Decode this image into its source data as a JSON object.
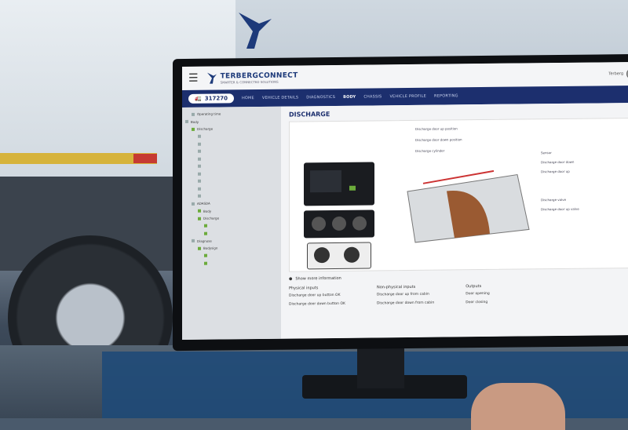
{
  "app": {
    "brand_name": "TERBERGCONNECT",
    "brand_tagline": "SMARTER & CONNECTED SOLUTIONS",
    "user_name": "Terberg"
  },
  "vehicle": {
    "id": "317270"
  },
  "nav": {
    "items": [
      "HOME",
      "VEHICLE DETAILS",
      "DIAGNOSTICS",
      "BODY",
      "CHASSIS",
      "VEHICLE PROFILE",
      "REPORTING"
    ],
    "active": "BODY"
  },
  "page": {
    "title": "DISCHARGE",
    "info": "Show more information"
  },
  "tree": [
    {
      "label": "Operating time",
      "level": 1,
      "status": "none"
    },
    {
      "label": "Body",
      "level": 0,
      "status": "none"
    },
    {
      "label": "Discharge",
      "level": 1,
      "status": "green"
    },
    {
      "label": "ADASDA",
      "level": 1,
      "status": "none"
    },
    {
      "label": "Body",
      "level": 2,
      "status": "green"
    },
    {
      "label": "Discharge",
      "level": 2,
      "status": "green"
    },
    {
      "label": "Diagnose",
      "level": 1,
      "status": "none"
    },
    {
      "label": "Bodysign",
      "level": 2,
      "status": "green"
    }
  ],
  "diagram": {
    "labels_left": [
      "Discharge door up position",
      "Discharge door down position",
      "Discharge cylinder"
    ],
    "labels_right": [
      "Sensor",
      "Discharge door down",
      "Discharge door up",
      "Discharge valve",
      "Discharge door up valve"
    ]
  },
  "sections": {
    "physical_inputs": {
      "title": "Physical inputs",
      "items": [
        "Discharge door up button OK",
        "Discharge door down button OK"
      ]
    },
    "non_physical_inputs": {
      "title": "Non-physical inputs",
      "items": [
        "Discharge door up from cabin",
        "Discharge door down from cabin"
      ]
    },
    "outputs": {
      "title": "Outputs",
      "items": [
        "Door opening",
        "Door closing"
      ]
    }
  },
  "colors": {
    "nav_bg": "#1c2f6e",
    "accent_green": "#6cab3b",
    "brand_blue": "#1d3a7a"
  }
}
